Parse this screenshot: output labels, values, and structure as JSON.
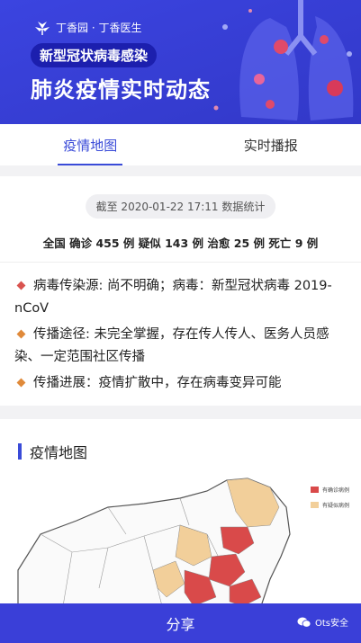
{
  "banner": {
    "brand": "丁香园 · 丁香医生",
    "subtitle": "新型冠状病毒感染",
    "title": "肺炎疫情实时动态"
  },
  "tabs": [
    {
      "label": "疫情地图",
      "active": true
    },
    {
      "label": "实时播报",
      "active": false
    }
  ],
  "stats": {
    "as_of": "截至 2020-01-22 17:11 数据统计",
    "totals": "全国 确诊 455 例 疑似 143 例 治愈 25 例 死亡 9 例"
  },
  "info": [
    {
      "text": "病毒传染源: 尚不明确；病毒：新型冠状病毒 2019-nCoV",
      "color": "#d9534f"
    },
    {
      "text": "传播途径: 未完全掌握，存在传人传人、医务人员感染、一定范围社区传播",
      "color": "#e08a3a"
    },
    {
      "text": "传播进展：疫情扩散中，存在病毒变异可能",
      "color": "#e08a3a"
    }
  ],
  "map_section": {
    "title": "疫情地图",
    "legend": [
      {
        "label": "有确诊病例",
        "color": "#d94a4a"
      },
      {
        "label": "有疑似病例",
        "color": "#f2cf9a"
      }
    ]
  },
  "share": {
    "label": "分享"
  },
  "watermark": {
    "label": "Ots安全"
  },
  "colors": {
    "brand": "#3a3fd8",
    "accent": "#3a4bd8"
  }
}
